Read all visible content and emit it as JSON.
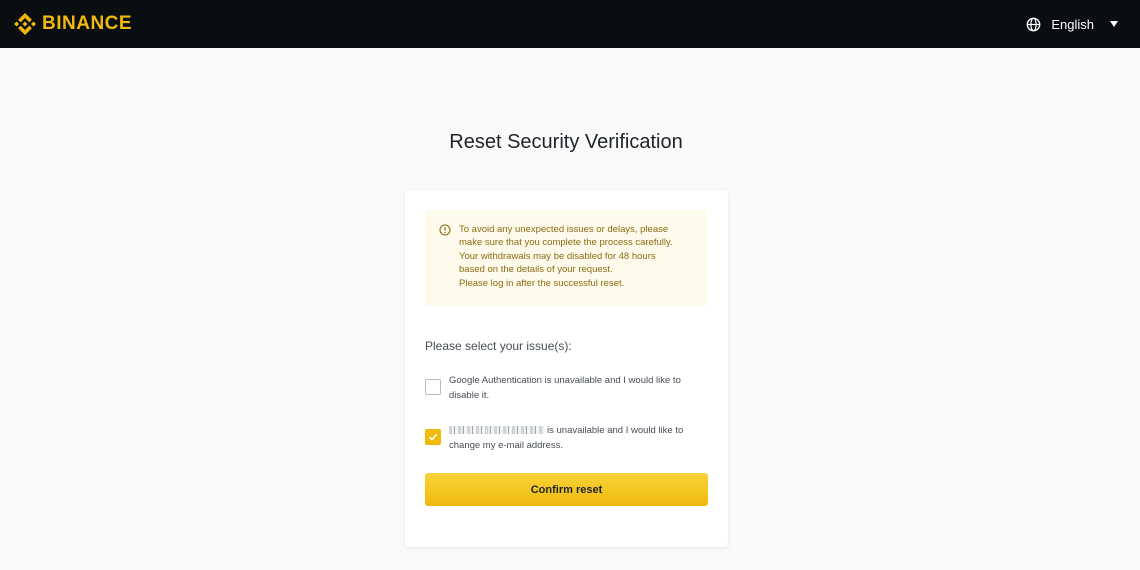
{
  "header": {
    "brand": "BINANCE",
    "language": "English",
    "icons": {
      "logo": "binance-logo",
      "language": "globe-icon",
      "caret": "caret-down-icon"
    }
  },
  "page": {
    "title": "Reset Security Verification"
  },
  "notice": {
    "icon": "info-circle-icon",
    "lines": [
      "To avoid any unexpected issues or delays, please",
      "make sure that you complete the process carefully.",
      "Your withdrawals may be disabled for 48 hours",
      "based on the details of your request.",
      "Please log in after the successful reset."
    ]
  },
  "form": {
    "select_label": "Please select your issue(s):",
    "options": [
      {
        "text": "Google Authentication is unavailable and I would like to disable it.",
        "checked": false
      },
      {
        "text": "is unavailable and I would like to change my e-mail address.",
        "checked": true
      }
    ],
    "confirm_label": "Confirm reset"
  },
  "colors": {
    "brand_yellow": "#F0B90B",
    "topbar_bg": "#0B0E11",
    "notice_bg": "#FEFBEC",
    "notice_text": "#8C6A12"
  }
}
